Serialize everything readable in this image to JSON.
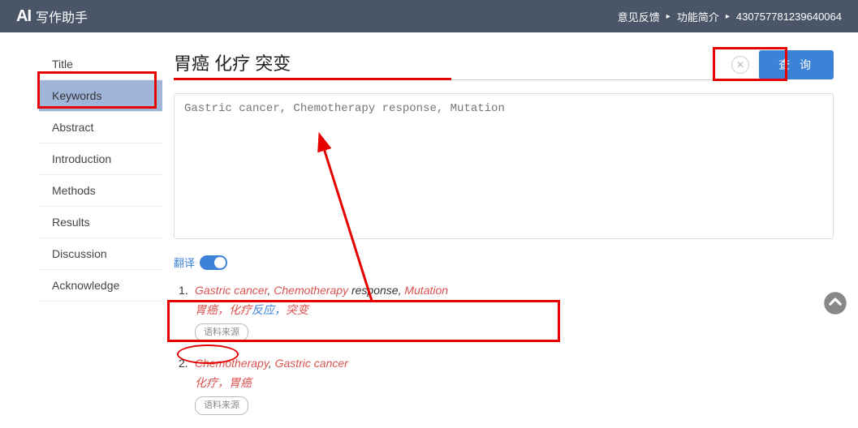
{
  "header": {
    "logo_icon": "AI",
    "logo_text": "写作助手",
    "links": {
      "feedback": "意见反馈",
      "features": "功能简介",
      "userid": "430757781239640064"
    }
  },
  "sidebar": {
    "items": [
      {
        "label": "Title"
      },
      {
        "label": "Keywords"
      },
      {
        "label": "Abstract"
      },
      {
        "label": "Introduction"
      },
      {
        "label": "Methods"
      },
      {
        "label": "Results"
      },
      {
        "label": "Discussion"
      },
      {
        "label": "Acknowledge"
      }
    ],
    "active_index": 1
  },
  "search": {
    "value": "胃癌 化疗 突变",
    "query_btn": "查 询"
  },
  "textarea": {
    "placeholder": "Gastric cancer, Chemotherapy response, Mutation"
  },
  "translate": {
    "label": "翻译"
  },
  "results": [
    {
      "num": "1.",
      "en_parts": [
        {
          "t": "Gastric cancer",
          "hl": true
        },
        {
          "t": ", ",
          "hl": false
        },
        {
          "t": "Chemotherapy",
          "hl": true
        },
        {
          "t": " response, ",
          "hl": false
        },
        {
          "t": "Mutation",
          "hl": true
        }
      ],
      "zh_parts": [
        {
          "t": "胃癌，化疗",
          "hl": true
        },
        {
          "t": "反应，",
          "hl": false
        },
        {
          "t": "突变",
          "hl": true
        }
      ],
      "source": "语料来源"
    },
    {
      "num": "2.",
      "en_parts": [
        {
          "t": "Chemotherapy",
          "hl": true
        },
        {
          "t": ", ",
          "hl": false
        },
        {
          "t": "Gastric cancer",
          "hl": true
        }
      ],
      "zh_parts": [
        {
          "t": "化疗，胃癌",
          "hl": true
        }
      ],
      "source": "语料来源"
    }
  ]
}
